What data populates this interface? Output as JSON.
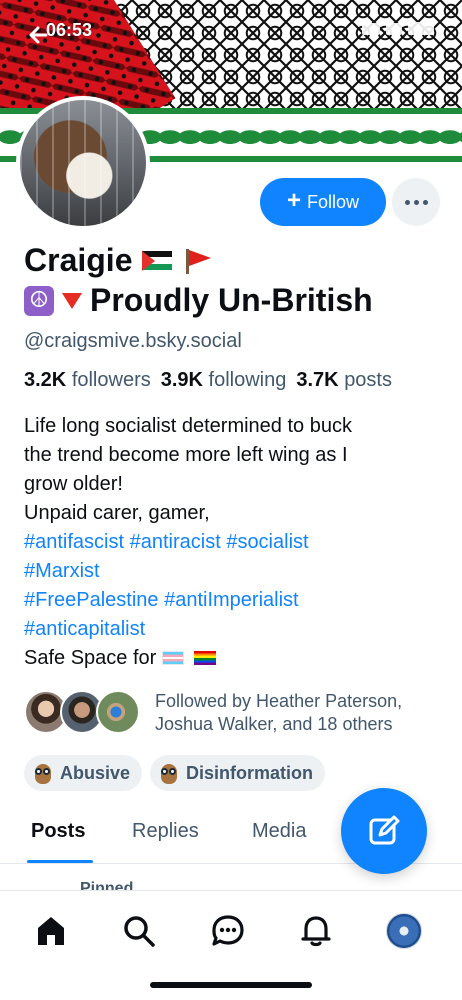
{
  "status_bar": {
    "time": "06:53"
  },
  "profile": {
    "display_name": "Craigie",
    "tagline": "Proudly Un-British",
    "handle": "@craigsmive.bsky.social",
    "stats": {
      "followers_count": "3.2K",
      "followers_label": "followers",
      "following_count": "3.9K",
      "following_label": "following",
      "posts_count": "3.7K",
      "posts_label": "posts"
    },
    "follow_label": "Follow",
    "bio": {
      "line1": "Life long socialist determined to buck",
      "line2": "the trend become more left wing as I",
      "line3": "grow older!",
      "line4": "Unpaid carer, gamer,",
      "tags_line1": "#antifascist #antiracist #socialist",
      "tags_line2": "#Marxist",
      "tags_line3": "#FreePalestine #antiImperialist",
      "tags_line4": "#anticapitalist",
      "last_line": "Safe Space for"
    },
    "followed_by": "Followed by Heather Paterson, Joshua Walker, and 18 others",
    "labels": [
      "Abusive",
      "Disinformation"
    ]
  },
  "tabs": [
    "Posts",
    "Replies",
    "Media"
  ],
  "pinned_label": "Pinned",
  "icons": {
    "back": "arrow-left-icon",
    "more": "ellipsis-icon",
    "compose": "compose-icon",
    "nav": [
      "home-icon",
      "search-icon",
      "chat-icon",
      "bell-icon",
      "profile-avatar-icon"
    ]
  },
  "colors": {
    "accent": "#1083fe",
    "muted_text": "#42576c",
    "text": "#0b0f14"
  }
}
